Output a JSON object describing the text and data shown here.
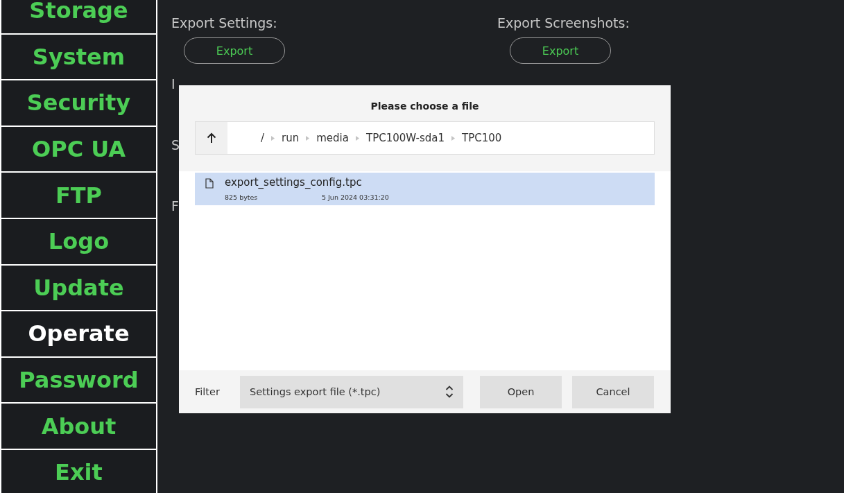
{
  "sidebar": {
    "items": [
      {
        "label": "Storage",
        "selected": false
      },
      {
        "label": "System",
        "selected": false
      },
      {
        "label": "Security",
        "selected": false
      },
      {
        "label": "OPC UA",
        "selected": false
      },
      {
        "label": "FTP",
        "selected": false
      },
      {
        "label": "Logo",
        "selected": false
      },
      {
        "label": "Update",
        "selected": false
      },
      {
        "label": "Operate",
        "selected": true
      },
      {
        "label": "Password",
        "selected": false
      },
      {
        "label": "About",
        "selected": false
      },
      {
        "label": "Exit",
        "selected": false
      }
    ]
  },
  "main": {
    "sections": [
      {
        "label": "Export Settings:",
        "button": "Export"
      },
      {
        "label": "Export Screenshots:",
        "button": "Export"
      }
    ],
    "partial_labels": [
      "I",
      "S",
      "F"
    ]
  },
  "dialog": {
    "title": "Please choose a file",
    "path": [
      "/",
      "run",
      "media",
      "TPC100W-sda1",
      "TPC100"
    ],
    "files": [
      {
        "name": "export_settings_config.tpc",
        "size": "825 bytes",
        "date": "5 Jun 2024 03:31:20",
        "selected": true
      }
    ],
    "filter_label": "Filter",
    "filter_value": "Settings export file (*.tpc)",
    "buttons": [
      "Open",
      "Cancel"
    ]
  }
}
